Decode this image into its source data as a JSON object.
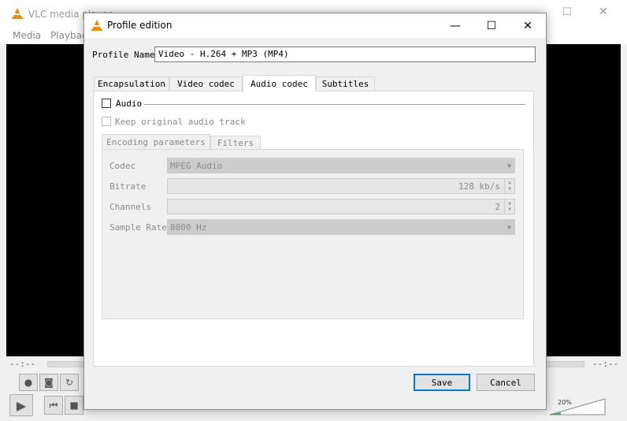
{
  "vlc": {
    "title": "VLC media player",
    "menu": [
      "Media",
      "Playback"
    ],
    "time_left": "--:--",
    "time_right": "--:--",
    "volume": "20%"
  },
  "dialog": {
    "title": "Profile edition",
    "profile_name_label": "Profile Name",
    "profile_name_value": "Video - H.264 + MP3 (MP4)",
    "tabs": [
      "Encapsulation",
      "Video codec",
      "Audio codec",
      "Subtitles"
    ],
    "active_tab": "Audio codec",
    "audio": {
      "enable_label": "Audio",
      "keep_label": "Keep original audio track",
      "subtabs": [
        "Encoding parameters",
        "Filters"
      ],
      "codec_label": "Codec",
      "codec_value": "MPEG Audio",
      "bitrate_label": "Bitrate",
      "bitrate_value": "128 kb/s",
      "channels_label": "Channels",
      "channels_value": "2",
      "sample_rate_label": "Sample Rate",
      "sample_rate_value": "8000 Hz"
    },
    "save_label": "Save",
    "cancel_label": "Cancel"
  },
  "colors": {
    "accent": "#0078d7",
    "vlc_orange": "#f08a00",
    "volume_green": "#3cb043"
  }
}
